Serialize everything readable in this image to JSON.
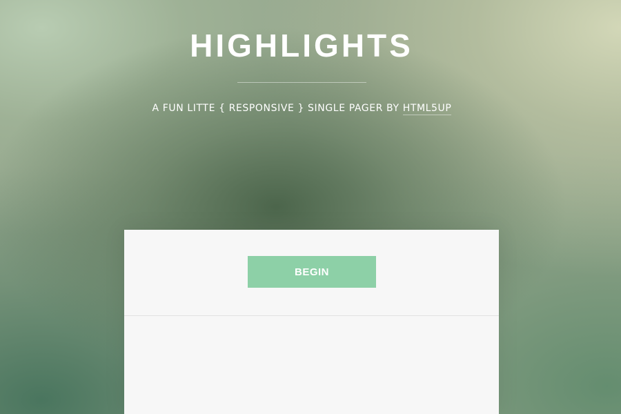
{
  "header": {
    "title": "HIGHLIGHTS",
    "tagline_prefix": "A FUN LITTE { RESPONSIVE } SINGLE PAGER BY ",
    "tagline_link": "HTML5UP"
  },
  "panel": {
    "begin_label": "BEGIN"
  },
  "colors": {
    "accent": "#8dd0a7",
    "panel_bg": "#f7f7f7",
    "text_light": "#ffffff"
  }
}
